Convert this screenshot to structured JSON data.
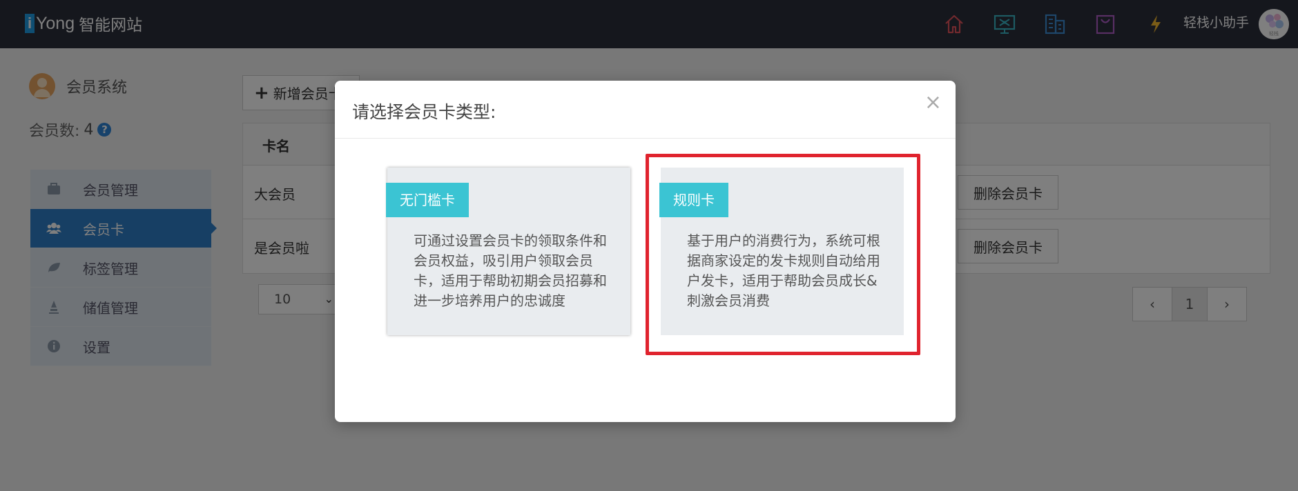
{
  "app": {
    "logo_i": "i",
    "logo_text": "Yong",
    "logo_sub": "智能网站"
  },
  "nav": {
    "icons": [
      "home-icon",
      "monitor-icon",
      "building-icon",
      "bag-icon",
      "bolt-icon"
    ],
    "assistant_label": "轻栈小助手",
    "avatar_text": "轻栈"
  },
  "sidebar": {
    "title": "会员系统",
    "member_count_label": "会员数:",
    "member_count": "4",
    "items": [
      {
        "label": "会员管理",
        "icon": "briefcase-icon",
        "active": false
      },
      {
        "label": "会员卡",
        "icon": "users-icon",
        "active": true
      },
      {
        "label": "标签管理",
        "icon": "leaf-icon",
        "active": false
      },
      {
        "label": "储值管理",
        "icon": "pen-icon",
        "active": false
      },
      {
        "label": "设置",
        "icon": "info-icon",
        "active": false
      }
    ]
  },
  "main": {
    "add_button_label": "新增会员卡",
    "table_header": "卡名",
    "rows": [
      {
        "name": "大会员",
        "action": "删除会员卡"
      },
      {
        "name": "是会员啦",
        "action": "删除会员卡"
      }
    ],
    "page_size": "10",
    "pager": {
      "prev": "‹",
      "current": "1",
      "next": "›"
    }
  },
  "modal": {
    "title": "请选择会员卡类型:",
    "close": "×",
    "cards": [
      {
        "tag": "无门槛卡",
        "desc": "可通过设置会员卡的领取条件和会员权益，吸引用户领取会员卡，适用于帮助初期会员招募和进一步培养用户的忠诚度"
      },
      {
        "tag": "规则卡",
        "desc": "基于用户的消费行为，系统可根据商家设定的发卡规则自动给用户发卡，适用于帮助会员成长&刺激会员消费"
      }
    ]
  },
  "colors": {
    "topbar": "#2b2e3b",
    "accent": "#2f7fc8",
    "tag": "#3bc4d3",
    "highlight": "#e0232e"
  }
}
